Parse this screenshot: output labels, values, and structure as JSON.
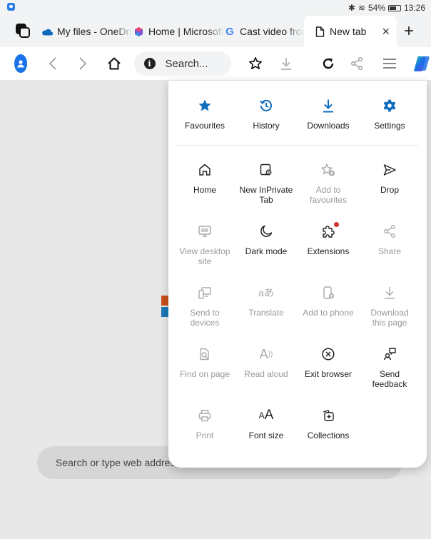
{
  "status_bar": {
    "battery": "54%",
    "time": "13:26"
  },
  "tabs": [
    {
      "title": "My files - OneDrive",
      "icon": "onedrive-icon"
    },
    {
      "title": "Home | Microsoft",
      "icon": "microsoft-365-icon"
    },
    {
      "title": "Cast video from",
      "icon": "google-icon"
    },
    {
      "title": "New tab",
      "icon": "page-icon",
      "active": true
    }
  ],
  "toolbar": {
    "omnibox_text": "Search..."
  },
  "page": {
    "search_placeholder": "Search or type web address"
  },
  "menu": {
    "top_row": [
      {
        "label": "Favourites",
        "icon": "star-icon"
      },
      {
        "label": "History",
        "icon": "history-icon"
      },
      {
        "label": "Downloads",
        "icon": "download-icon"
      },
      {
        "label": "Settings",
        "icon": "gear-icon"
      }
    ],
    "grid": [
      {
        "label": "Home",
        "icon": "home-icon",
        "enabled": true
      },
      {
        "label": "New InPrivate Tab",
        "icon": "inprivate-icon",
        "enabled": true
      },
      {
        "label": "Add to favourites",
        "icon": "star-add-icon",
        "enabled": false
      },
      {
        "label": "Drop",
        "icon": "send-icon",
        "enabled": true
      },
      {
        "label": "View desktop site",
        "icon": "desktop-icon",
        "enabled": false
      },
      {
        "label": "Dark mode",
        "icon": "moon-icon",
        "enabled": true
      },
      {
        "label": "Extensions",
        "icon": "puzzle-icon",
        "enabled": true
      },
      {
        "label": "Share",
        "icon": "share-icon",
        "enabled": false
      },
      {
        "label": "Send to devices",
        "icon": "devices-icon",
        "enabled": false
      },
      {
        "label": "Translate",
        "icon": "translate-icon",
        "enabled": false
      },
      {
        "label": "Add to phone",
        "icon": "phone-add-icon",
        "enabled": false
      },
      {
        "label": "Download this page",
        "icon": "download-page-icon",
        "enabled": false
      },
      {
        "label": "Find on page",
        "icon": "find-icon",
        "enabled": false
      },
      {
        "label": "Read aloud",
        "icon": "read-aloud-icon",
        "enabled": false
      },
      {
        "label": "Exit browser",
        "icon": "exit-icon",
        "enabled": true
      },
      {
        "label": "Send feedback",
        "icon": "feedback-icon",
        "enabled": true
      },
      {
        "label": "Print",
        "icon": "print-icon",
        "enabled": false
      },
      {
        "label": "Font size",
        "icon": "font-size-icon",
        "enabled": true
      },
      {
        "label": "Collections",
        "icon": "collections-icon",
        "enabled": true
      }
    ]
  },
  "colors": {
    "accent": "#0f6cbd",
    "disabled_text": "#9a9a9a",
    "page_bg": "#e8e8e8",
    "notification_dot": "#d13438"
  }
}
